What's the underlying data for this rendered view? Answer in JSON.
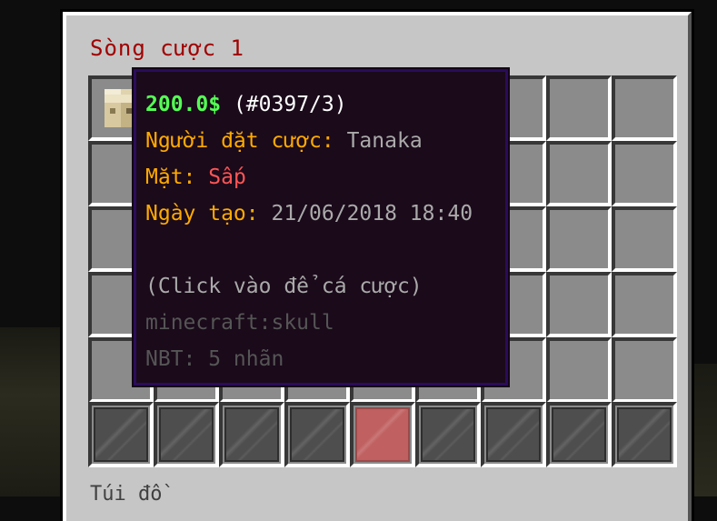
{
  "window": {
    "title": "Sòng cược 1",
    "inventory_label": "Túi đồ"
  },
  "grid": {
    "rows": 5,
    "cols": 9,
    "items": [
      {
        "row": 0,
        "col": 0,
        "icon": "skull-icon"
      }
    ]
  },
  "hotbar": {
    "slots": 9,
    "selected_index": 4,
    "icon": "glass-pane-icon"
  },
  "tooltip": {
    "price": "200.0$",
    "id": "(#0397/3)",
    "bettor_label": "Người đặt cược:",
    "bettor_value": "Tanaka",
    "face_label": "Mặt:",
    "face_value": "Sấp",
    "date_label": "Ngày tạo:",
    "date_value": "21/06/2018 18:40",
    "click_hint": "(Click vào để cá cược)",
    "item_id": "minecraft:skull",
    "nbt": "NBT: 5 nhãn"
  },
  "colors": {
    "title": "#a00000",
    "price": "#55ff55",
    "label_gold": "#ffaa00",
    "face_red": "#ff5555",
    "tooltip_bg": "#1a0a1a",
    "tooltip_border": "#2a0c5a"
  }
}
